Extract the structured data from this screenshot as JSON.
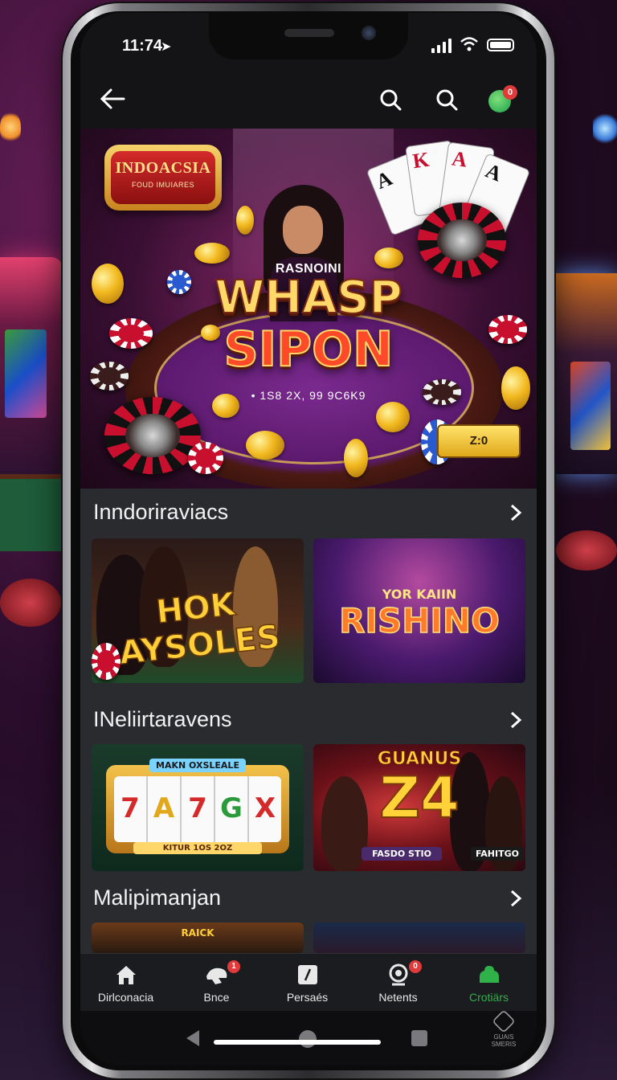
{
  "status": {
    "time": "11:74"
  },
  "hero": {
    "badge_title": "INDOACSIA",
    "badge_sub": "FOUD IMUIARES",
    "tagline": "RASNOINI",
    "title_line1": "WHASP",
    "title_line2": "SIPON",
    "sub": "• 1S8 2X, 99 9C6K9",
    "button": "Z:0",
    "cards": [
      "A",
      "K",
      "A",
      "A"
    ]
  },
  "sections": [
    {
      "title": "Inndoriraviacs",
      "tiles": [
        {
          "text": "HOK AYSOLES"
        },
        {
          "text_small": "YOR KAIIN",
          "text": "RISHINO"
        }
      ]
    },
    {
      "title": "INeliirtaravens",
      "tiles": [
        {
          "banner": "MAKN OXSLEALE",
          "reels": [
            "7",
            "A",
            "7",
            "G",
            "X"
          ],
          "footer": "KITUR 1OS 2OZ"
        },
        {
          "top": "GUANUS",
          "big": "Z4",
          "label1": "FASDO STIO",
          "label2": "FAHITGO"
        }
      ]
    },
    {
      "title": "Malipimanjan",
      "tiles": [
        {
          "text": "RAICK"
        },
        {
          "text": ""
        }
      ]
    }
  ],
  "nav": [
    {
      "label": "Dirlconacia",
      "icon": "home-icon",
      "badge": ""
    },
    {
      "label": "Bnce",
      "icon": "hand-icon",
      "badge": "1"
    },
    {
      "label": "Persaés",
      "icon": "edit-icon",
      "badge": ""
    },
    {
      "label": "Netents",
      "icon": "webcam-icon",
      "badge": "0"
    },
    {
      "label": "Crotiärs",
      "icon": "stack-icon",
      "badge": ""
    }
  ],
  "appbar": {
    "notif_badge": "0"
  },
  "watermark": "GUAIS SMERIS",
  "colors": {
    "accent": "#2fb24a",
    "badge": "#e03a3a",
    "panel": "#2a2b2f"
  }
}
